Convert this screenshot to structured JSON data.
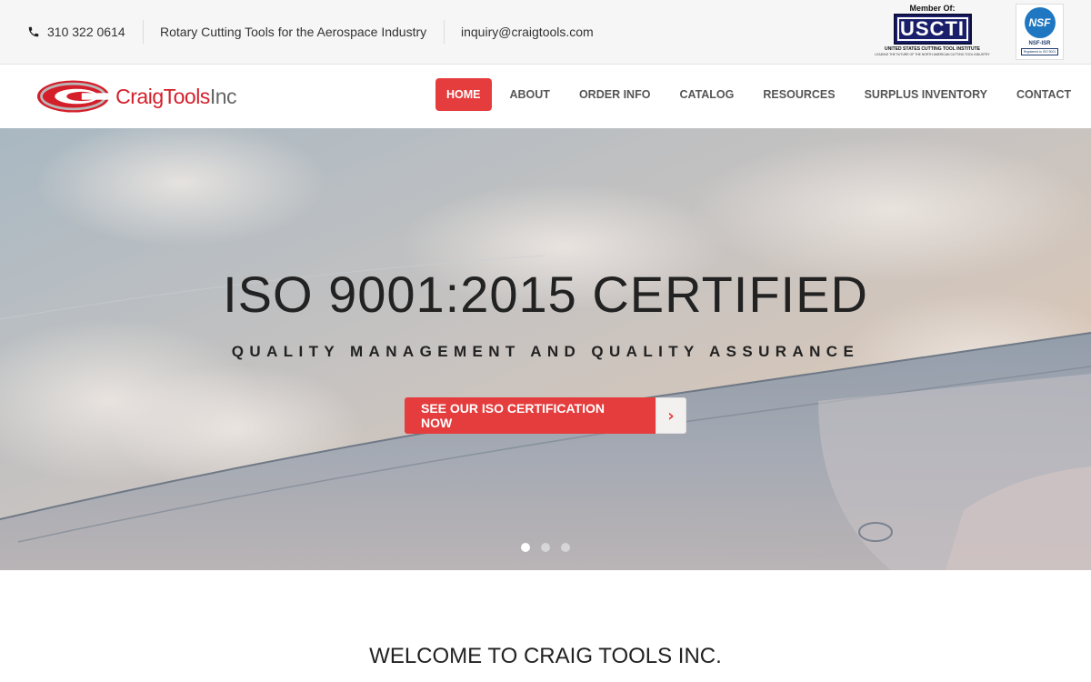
{
  "topbar": {
    "phone": "310 322 0614",
    "tagline": "Rotary Cutting Tools for the Aerospace Industry",
    "email": "inquiry@craigtools.com",
    "usscti": {
      "member_of": "Member Of:",
      "acronym": "USCTI",
      "caption": "UNITED STATES CUTTING TOOL INSTITUTE",
      "sub": "LEADING THE FUTURE OF THE NORTH AMERICAN CUTTING TOOL INDUSTRY"
    },
    "nsf": {
      "mark": "NSF",
      "label": "NSF-ISR",
      "registered": "Registered to ISO 9001"
    }
  },
  "header": {
    "brand_name": "CraigTools",
    "brand_suffix": "Inc",
    "nav": [
      {
        "label": "HOME",
        "active": true
      },
      {
        "label": "ABOUT"
      },
      {
        "label": "ORDER INFO"
      },
      {
        "label": "CATALOG"
      },
      {
        "label": "RESOURCES"
      },
      {
        "label": "SURPLUS INVENTORY"
      },
      {
        "label": "CONTACT"
      }
    ]
  },
  "hero": {
    "title": "ISO 9001:2015 CERTIFIED",
    "subtitle": "QUALITY MANAGEMENT AND QUALITY ASSURANCE",
    "cta_label": "SEE OUR ISO CERTIFICATION NOW",
    "cta_arrow": "›",
    "slide_count": 3,
    "active_slide": 1
  },
  "welcome": {
    "heading": "WELCOME TO CRAIG TOOLS INC."
  },
  "colors": {
    "accent": "#e53d3d",
    "brand_red": "#d41f2a",
    "topbar_bg": "#f6f6f6",
    "usscti_blue": "#1a1f6b",
    "nsf_blue": "#1e77c0"
  },
  "icons": {
    "phone": "phone-icon",
    "cta_arrow": "chevron-right-icon"
  }
}
